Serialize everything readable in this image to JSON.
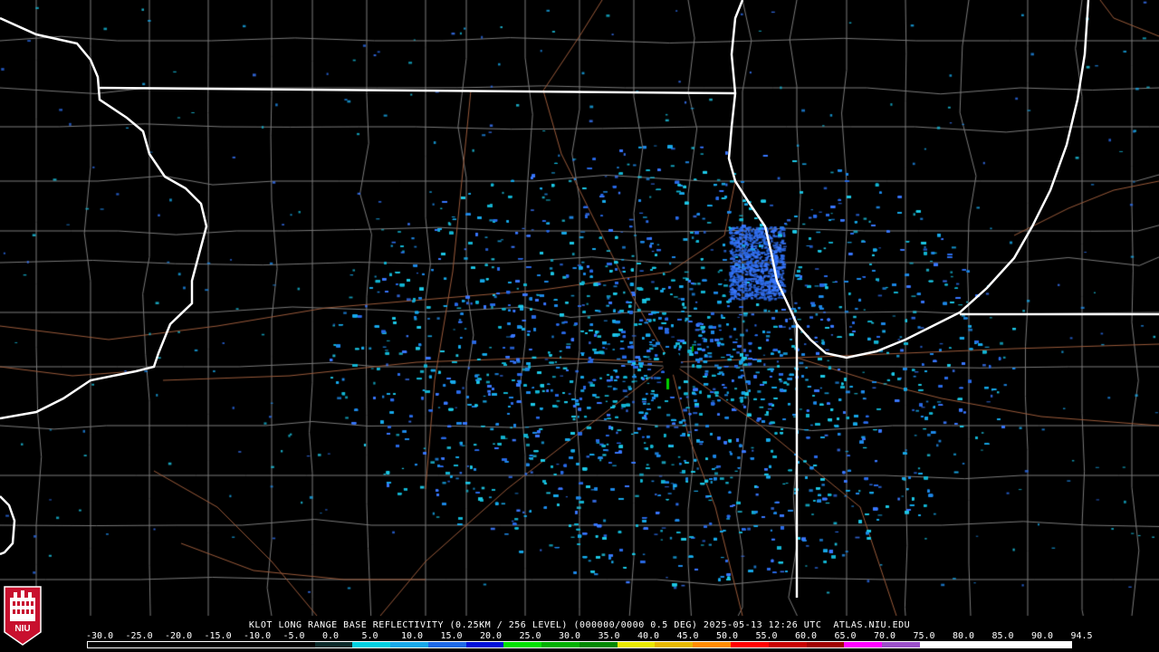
{
  "caption": "KLOT LONG RANGE BASE REFLECTIVITY (0.25KM / 256 LEVEL) (000000/0000 0.5 DEG) 2025-05-13 12:26 UTC  ATLAS.NIU.EDU",
  "colorbar": {
    "values": [
      "-30.0",
      "-25.0",
      "-20.0",
      "-15.0",
      "-10.0",
      "-5.0",
      "0.0",
      "5.0",
      "10.0",
      "15.0",
      "20.0",
      "25.0",
      "30.0",
      "35.0",
      "40.0",
      "45.0",
      "50.0",
      "55.0",
      "60.0",
      "65.0",
      "70.0",
      "75.0",
      "80.0",
      "85.0",
      "90.0",
      "94.5"
    ],
    "colors": [
      "#000000",
      "#000000",
      "#000000",
      "#000000",
      "#000000",
      "#000000",
      "#0f3c3c",
      "#00e6e6",
      "#18a8e8",
      "#1e6ae6",
      "#0010d8",
      "#00f000",
      "#00c000",
      "#009000",
      "#ffff00",
      "#e6c000",
      "#ff9000",
      "#ff0000",
      "#d00000",
      "#b00000",
      "#ff00ff",
      "#9a50c8",
      "#ffffff",
      "#ffffff",
      "#ffffff",
      "#ffffff"
    ]
  },
  "logo": {
    "text": "NIU",
    "color": "#c8102e"
  },
  "map": {
    "radar_site": "KLOT",
    "echo_colors": [
      "#1ec8e6",
      "#18a8e8",
      "#1e88e6",
      "#2a6ae6",
      "#3a78ff",
      "#14b4d2"
    ],
    "state_border_color": "#ffffff",
    "county_line_color": "#7a7a7a",
    "road_color": "#9a5a3a"
  }
}
